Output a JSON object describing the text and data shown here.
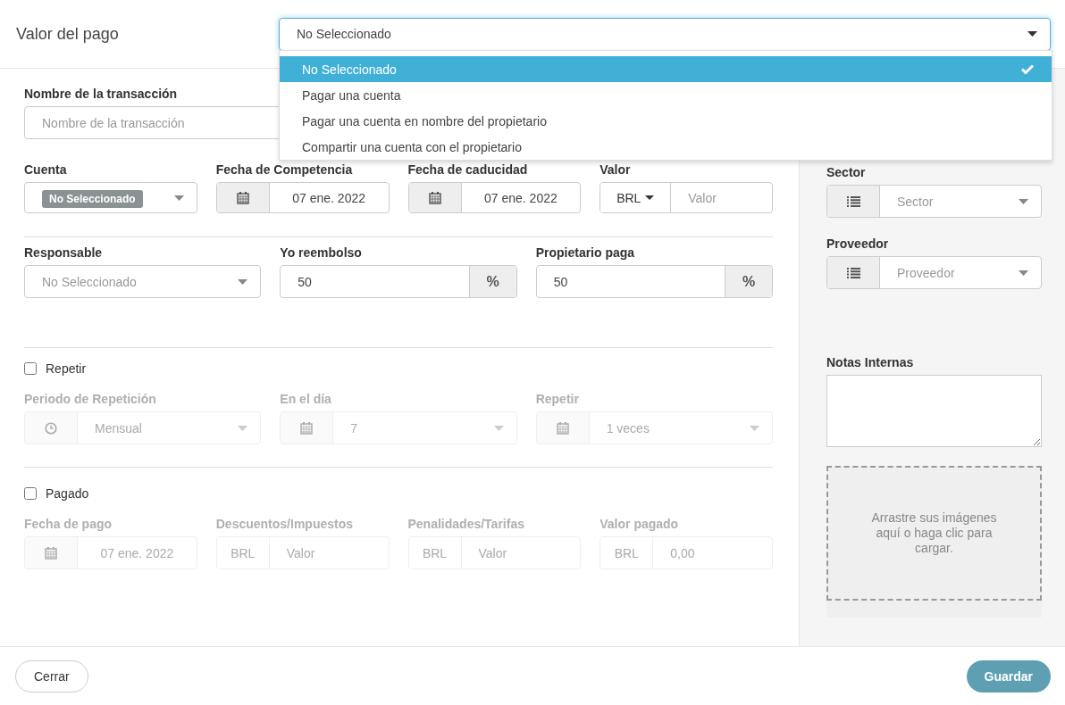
{
  "header": {
    "title": "Valor del pago",
    "select": {
      "value": "No Seleccionado",
      "open": true
    },
    "options": [
      {
        "label": "No Seleccionado",
        "selected": true
      },
      {
        "label": "Pagar una cuenta",
        "selected": false
      },
      {
        "label": "Pagar una cuenta en nombre del propietario",
        "selected": false
      },
      {
        "label": "Compartir una cuenta con el propietario",
        "selected": false
      }
    ]
  },
  "transaction": {
    "label": "Nombre de la transacción",
    "placeholder": "Nombre de la transacción"
  },
  "row_1": [
    {
      "kind": "badge-select",
      "label": "Cuenta",
      "value": "No Seleccionado"
    },
    {
      "kind": "date",
      "label": "Fecha de Competencia",
      "value": "07 ene. 2022"
    },
    {
      "kind": "date",
      "label": "Fecha de caducidad",
      "value": "07 ene. 2022"
    },
    {
      "kind": "currency-select",
      "label": "Valor",
      "currency": "BRL",
      "placeholder": "Valor"
    }
  ],
  "row_2": [
    {
      "kind": "select",
      "label": "Responsable",
      "placeholder": "No Seleccionado"
    },
    {
      "kind": "percent",
      "label": "Yo reembolso",
      "value": "50",
      "unit": "%"
    },
    {
      "kind": "percent",
      "label": "Propietario paga",
      "value": "50",
      "unit": "%"
    }
  ],
  "repeat": {
    "label": "Repetir",
    "checked": false,
    "disabled": true,
    "fields": [
      {
        "kind": "clock-select",
        "label": "Periodo de Repetición",
        "value": "Mensual"
      },
      {
        "kind": "date-select",
        "label": "En el día",
        "value": "7"
      },
      {
        "kind": "date-select",
        "label": "Repetir",
        "value": "1 veces"
      }
    ]
  },
  "paid": {
    "label": "Pagado",
    "checked": false,
    "disabled": true,
    "fields": [
      {
        "kind": "date",
        "label": "Fecha de pago",
        "value": "07 ene. 2022"
      },
      {
        "kind": "currency",
        "label": "Descuentos/Impuestos",
        "currency": "BRL",
        "placeholder": "Valor"
      },
      {
        "kind": "currency",
        "label": "Penalidades/Tarifas",
        "currency": "BRL",
        "placeholder": "Valor"
      },
      {
        "kind": "currency",
        "label": "Valor pagado",
        "currency": "BRL",
        "value": "0,00"
      }
    ]
  },
  "sidebar": {
    "fields": [
      {
        "kind": "list-select",
        "label": "Sector",
        "placeholder": "Sector"
      },
      {
        "kind": "list-select",
        "label": "Proveedor",
        "placeholder": "Proveedor"
      }
    ],
    "notes": {
      "label": "Notas Internas"
    },
    "dropzone": {
      "text": "Arrastre sus imágenes aquí o haga clic para cargar."
    }
  },
  "footer": {
    "buttons": [
      {
        "kind": "secondary",
        "label": "Cerrar"
      },
      {
        "kind": "primary",
        "label": "Guardar"
      }
    ]
  }
}
